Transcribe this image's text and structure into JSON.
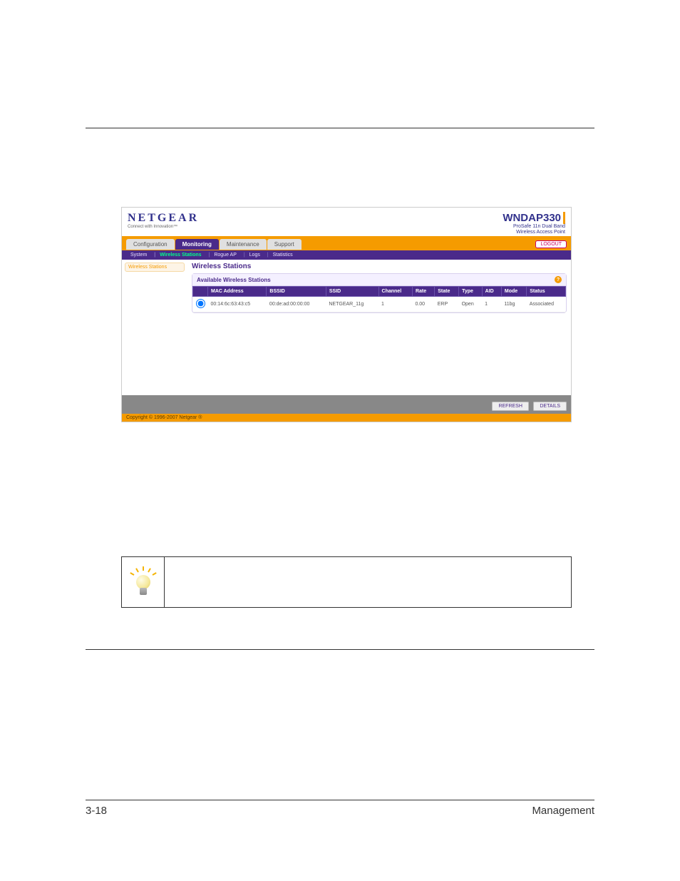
{
  "brand": {
    "name": "NETGEAR",
    "tagline": "Connect with Innovation™"
  },
  "product": {
    "model": "WNDAP330",
    "desc1": "ProSafe 11n Dual Band",
    "desc2": "Wireless Access Point"
  },
  "tabs": {
    "t0": "Configuration",
    "t1": "Monitoring",
    "t2": "Maintenance",
    "t3": "Support"
  },
  "logout": "LOGOUT",
  "subnav": {
    "s0": "System",
    "s1": "Wireless Stations",
    "s2": "Rogue AP",
    "s3": "Logs",
    "s4": "Statistics"
  },
  "sidebar": {
    "item0": "Wireless Stations"
  },
  "section_title": "Wireless Stations",
  "panel_title": "Available Wireless Stations",
  "help_icon": "?",
  "columns": {
    "c0": "",
    "c1": "MAC Address",
    "c2": "BSSID",
    "c3": "SSID",
    "c4": "Channel",
    "c5": "Rate",
    "c6": "State",
    "c7": "Type",
    "c8": "AID",
    "c9": "Mode",
    "c10": "Status"
  },
  "row0": {
    "mac": "00:14:6c:63:43:c5",
    "bssid": "00:de:ad:00:00:00",
    "ssid": "NETGEAR_11g",
    "channel": "1",
    "rate": "0.00",
    "state": "ERP",
    "type": "Open",
    "aid": "1",
    "mode": "11bg",
    "status": "Associated"
  },
  "actions": {
    "refresh": "REFRESH",
    "details": "DETAILS"
  },
  "copyright": "Copyright © 1996-2007 Netgear ®",
  "footer": {
    "left": "3-18",
    "right": "Management"
  }
}
